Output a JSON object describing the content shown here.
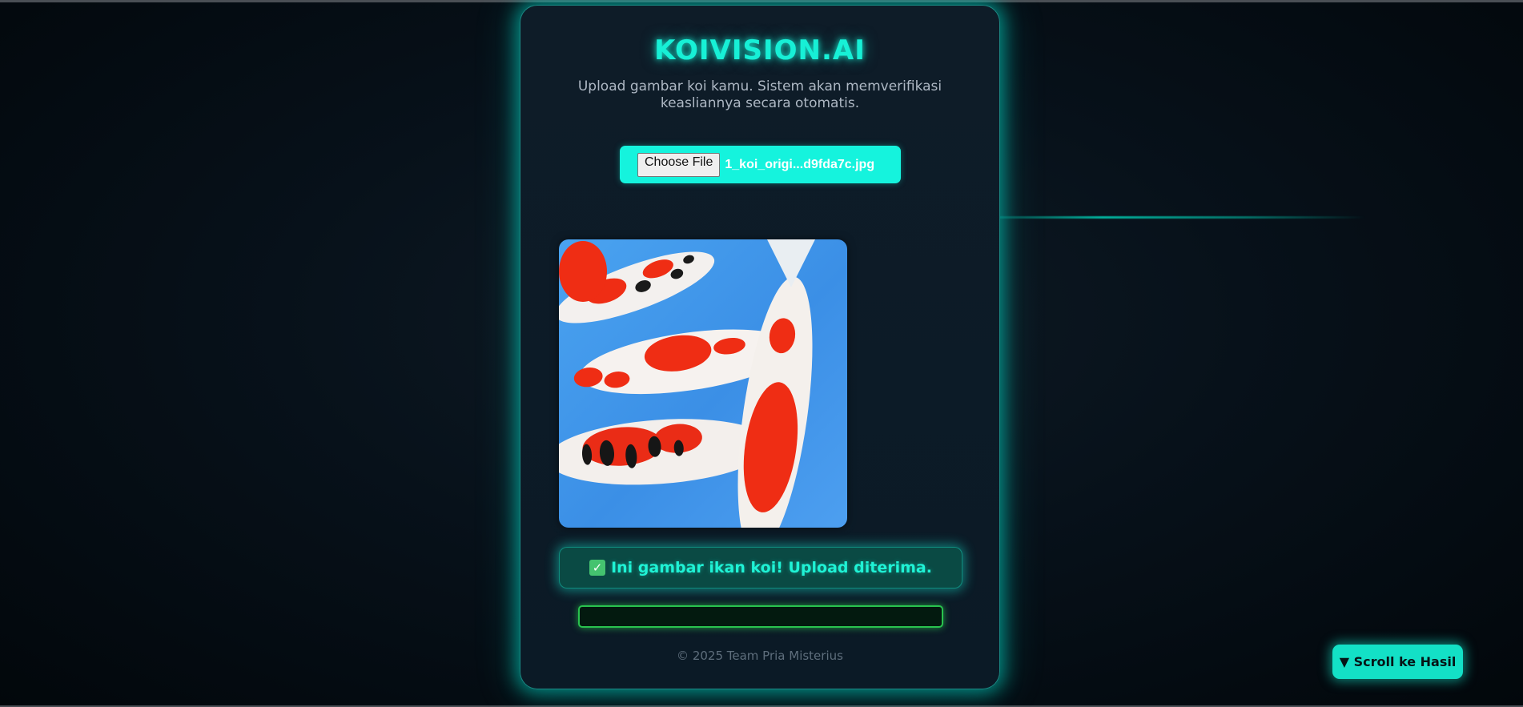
{
  "app": {
    "title": "KOIVISION.AI",
    "subtitle": "Upload gambar koi kamu. Sistem akan memverifikasi keasliannya secara otomatis."
  },
  "upload": {
    "button_label": "Choose File",
    "file_name": "1_koi_origi...d9fda7c.jpg"
  },
  "preview": {
    "icon": "koi-fish-photo"
  },
  "result": {
    "icon": "check-icon",
    "icon_glyph": "✓",
    "message": "Ini gambar ikan koi! Upload diterima."
  },
  "progress": {
    "fraction": 0
  },
  "footer": {
    "text": "© 2025 Team Pria Misterius"
  },
  "scroll_button": {
    "label": "▼ Scroll ke Hasil"
  },
  "colors": {
    "accent": "#17f0d6",
    "card_bg": "#0b1a26",
    "success": "#44c36f",
    "progress_border": "#29c24e"
  }
}
